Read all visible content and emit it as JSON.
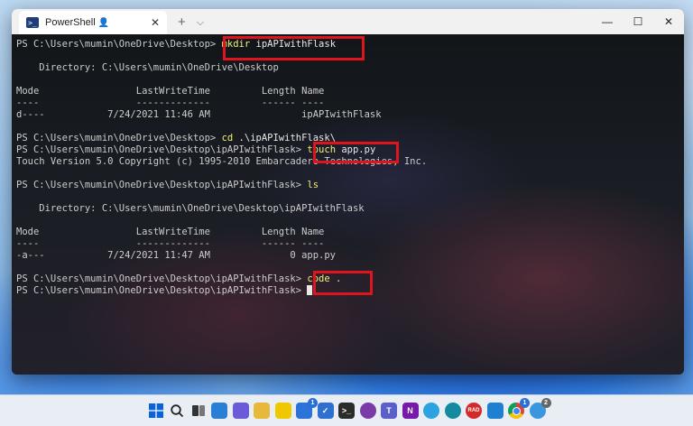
{
  "window": {
    "tab_title": "PowerShell",
    "tab_icon_glyph": ">_",
    "controls": [
      "minimize-icon",
      "maximize-icon",
      "close-icon"
    ]
  },
  "terminal": {
    "lines": [
      {
        "prompt": "PS C:\\Users\\mumin\\OneDrive\\Desktop> ",
        "cmd": "mkdir",
        "args": " ipAPIwithFlask"
      },
      {
        "text": ""
      },
      {
        "text": "    Directory: C:\\Users\\mumin\\OneDrive\\Desktop"
      },
      {
        "text": ""
      },
      {
        "text": "Mode                 LastWriteTime         Length Name"
      },
      {
        "text": "----                 -------------         ------ ----"
      },
      {
        "text": "d----           7/24/2021 11:46 AM                ipAPIwithFlask"
      },
      {
        "text": ""
      },
      {
        "prompt": "PS C:\\Users\\mumin\\OneDrive\\Desktop> ",
        "cmd": "cd",
        "args": " .\\ipAPIwithFlask\\"
      },
      {
        "prompt": "PS C:\\Users\\mumin\\OneDrive\\Desktop\\ipAPIwithFlask> ",
        "cmd": "touch",
        "args": " app.py"
      },
      {
        "text": "Touch Version 5.0 Copyright (c) 1995-2010 Embarcadero Technologies, Inc."
      },
      {
        "text": ""
      },
      {
        "prompt": "PS C:\\Users\\mumin\\OneDrive\\Desktop\\ipAPIwithFlask> ",
        "cmd": "ls",
        "args": ""
      },
      {
        "text": ""
      },
      {
        "text": "    Directory: C:\\Users\\mumin\\OneDrive\\Desktop\\ipAPIwithFlask"
      },
      {
        "text": ""
      },
      {
        "text": "Mode                 LastWriteTime         Length Name"
      },
      {
        "text": "----                 -------------         ------ ----"
      },
      {
        "text": "-a---           7/24/2021 11:47 AM              0 app.py"
      },
      {
        "text": ""
      },
      {
        "prompt": "PS C:\\Users\\mumin\\OneDrive\\Desktop\\ipAPIwithFlask> ",
        "cmd": "code",
        "args": " ."
      },
      {
        "prompt": "PS C:\\Users\\mumin\\OneDrive\\Desktop\\ipAPIwithFlask> ",
        "cursor": true
      }
    ]
  },
  "colors": {
    "highlight": "#e0141c",
    "command": "#f2f07a",
    "output": "#cccccc"
  },
  "taskbar": {
    "icons": [
      {
        "name": "start-icon",
        "glyph": "",
        "color": "#0a64d8"
      },
      {
        "name": "search-icon",
        "glyph": "⌕",
        "color": "#333333"
      },
      {
        "name": "task-view-icon",
        "glyph": "",
        "color": "#444444"
      },
      {
        "name": "widgets-icon",
        "glyph": "",
        "color": "#2a7fd4"
      },
      {
        "name": "chat-icon",
        "glyph": "",
        "color": "#6b5bd8"
      },
      {
        "name": "file-explorer-icon",
        "glyph": "",
        "color": "#e8b83a"
      },
      {
        "name": "sticky-notes-icon",
        "glyph": "",
        "color": "#f0c800"
      },
      {
        "name": "store-icon",
        "glyph": "",
        "color": "#2b73d6",
        "badge": "1"
      },
      {
        "name": "todo-icon",
        "glyph": "✓",
        "color": "#2f6fd0"
      },
      {
        "name": "terminal-icon",
        "glyph": ">_",
        "color": "#2b2b2b"
      },
      {
        "name": "tor-browser-icon",
        "glyph": "",
        "color": "#7a3aa8"
      },
      {
        "name": "teams-icon",
        "glyph": "T",
        "color": "#5b5fc7"
      },
      {
        "name": "onenote-icon",
        "glyph": "N",
        "color": "#7719aa"
      },
      {
        "name": "telegram-icon",
        "glyph": "",
        "color": "#2aa3e0"
      },
      {
        "name": "edge-icon",
        "glyph": "",
        "color": "#138a9f"
      },
      {
        "name": "rad-studio-icon",
        "glyph": "RAD",
        "color": "#d42a2a"
      },
      {
        "name": "vscode-icon",
        "glyph": "",
        "color": "#1f7fd1"
      },
      {
        "name": "chrome-icon",
        "glyph": "",
        "color": "#e6a81f",
        "badge": "1"
      },
      {
        "name": "telegram-2-icon",
        "glyph": "",
        "color": "#3a96dd",
        "badge": "2"
      }
    ]
  }
}
